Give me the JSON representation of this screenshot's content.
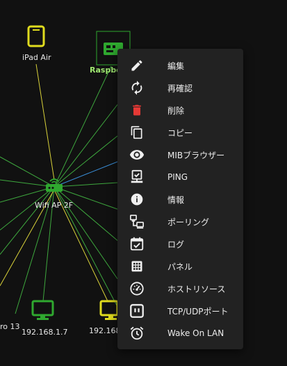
{
  "colors": {
    "background": "#111111",
    "link_green": "#3ea83e",
    "link_yellow": "#d9d23a",
    "link_blue": "#3a8fd9",
    "node_green": "#2fa82f",
    "node_yellow": "#e0dc1e",
    "menu_bg": "#222222",
    "delete_red": "#e53935"
  },
  "map": {
    "nodes": {
      "ipad": {
        "label": "iPad Air",
        "icon": "tablet-icon"
      },
      "raspberry": {
        "label": "Raspbe",
        "icon": "raspberry-pi-icon"
      },
      "wifi": {
        "label": "Wifi AP 2F",
        "icon": "wifi-router-icon"
      },
      "pro13": {
        "label": "ro 13",
        "icon": ""
      },
      "pc1": {
        "label": "192.168.1.7",
        "icon": "monitor-icon"
      },
      "pc2": {
        "label": "192.168",
        "icon": "monitor-icon"
      }
    }
  },
  "context_menu": {
    "items": [
      {
        "label": "編集",
        "icon": "pencil-icon"
      },
      {
        "label": "再確認",
        "icon": "refresh-icon"
      },
      {
        "label": "削除",
        "icon": "trash-icon"
      },
      {
        "label": "コピー",
        "icon": "copy-icon"
      },
      {
        "label": "MIBブラウザー",
        "icon": "eye-icon"
      },
      {
        "label": "PING",
        "icon": "ping-icon"
      },
      {
        "label": "情報",
        "icon": "info-icon"
      },
      {
        "label": "ポーリング",
        "icon": "polling-icon"
      },
      {
        "label": "ログ",
        "icon": "log-icon"
      },
      {
        "label": "パネル",
        "icon": "panel-icon"
      },
      {
        "label": "ホストリソース",
        "icon": "gauge-icon"
      },
      {
        "label": "TCP/UDPポート",
        "icon": "port-icon"
      },
      {
        "label": "Wake On LAN",
        "icon": "alarm-clock-icon"
      }
    ]
  }
}
